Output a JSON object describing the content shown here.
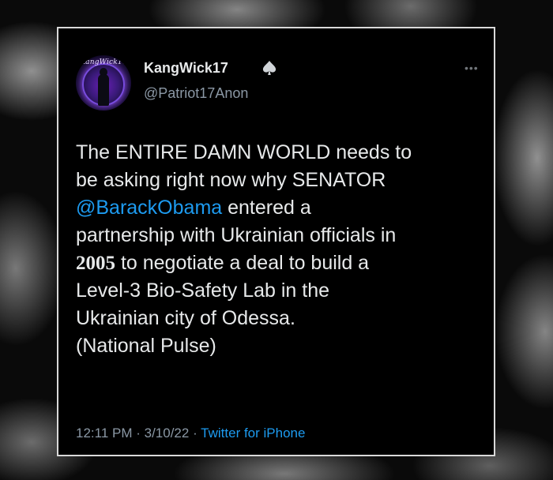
{
  "tweet": {
    "author": {
      "display_name": "KangWick17",
      "handle": "@Patriot17Anon",
      "avatar_text": "KangWick17",
      "badge_icon": "spade-icon"
    },
    "more_label": "•••",
    "body": {
      "line1": "The ENTIRE DAMN WORLD needs to",
      "line2": "be asking right now why SENATOR",
      "mention": "@BarackObama",
      "line3_rest": " entered a",
      "line4": "partnership with Ukrainian officials in",
      "year": "2005",
      "line5_rest": " to negotiate a deal to build a",
      "line6": "Level-3 Bio-Safety Lab in the",
      "line7": "Ukrainian city of Odessa.",
      "line8": "(National Pulse)"
    },
    "meta": {
      "time": "12:11 PM",
      "sep1": " · ",
      "date": "3/10/22",
      "sep2": " · ",
      "source": "Twitter for iPhone"
    }
  },
  "colors": {
    "background": "#000000",
    "text": "#e7e9ea",
    "secondary": "#8b98a5",
    "link": "#1d9bf0",
    "card_border": "#d9d9d9"
  }
}
